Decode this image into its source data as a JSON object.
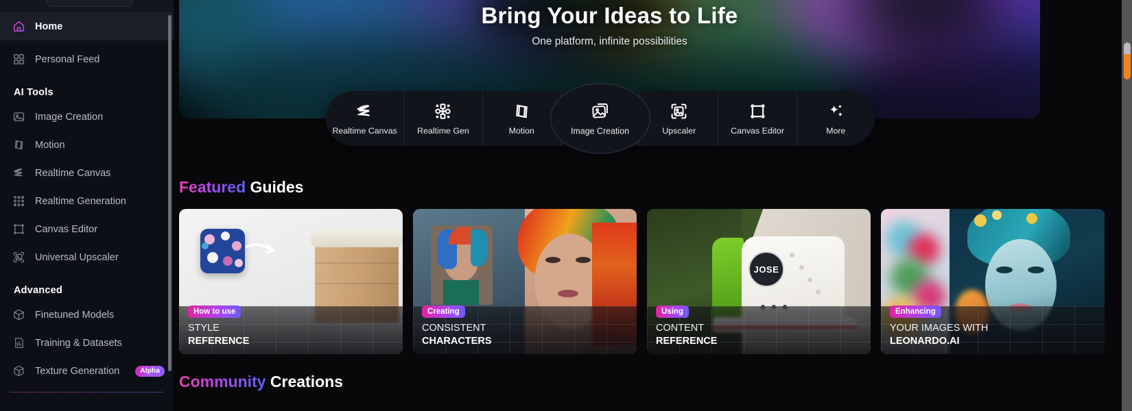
{
  "sidebar": {
    "primary": [
      {
        "label": "Home",
        "icon": "home-icon",
        "active": true
      },
      {
        "label": "Personal Feed",
        "icon": "grid-squares-icon",
        "active": false
      }
    ],
    "sections": [
      {
        "title": "AI Tools",
        "items": [
          {
            "label": "Image Creation",
            "icon": "image-icon"
          },
          {
            "label": "Motion",
            "icon": "film-strip-icon"
          },
          {
            "label": "Realtime Canvas",
            "icon": "scribble-icon"
          },
          {
            "label": "Realtime Generation",
            "icon": "dots-plus-icon"
          },
          {
            "label": "Canvas Editor",
            "icon": "frame-corners-icon"
          },
          {
            "label": "Universal Upscaler",
            "icon": "image-scan-icon"
          }
        ]
      },
      {
        "title": "Advanced",
        "items": [
          {
            "label": "Finetuned Models",
            "icon": "cube-icon"
          },
          {
            "label": "Training & Datasets",
            "icon": "training-icon"
          },
          {
            "label": "Texture Generation",
            "icon": "texture-cube-icon",
            "badge": "Alpha"
          }
        ]
      }
    ]
  },
  "hero": {
    "title": "Bring Your Ideas to Life",
    "subtitle": "One platform, infinite possibilities"
  },
  "toolbar": {
    "items": [
      {
        "label": "Realtime Canvas",
        "icon": "scribble-icon",
        "selected": false
      },
      {
        "label": "Realtime Gen",
        "icon": "dots-plus-icon",
        "selected": false
      },
      {
        "label": "Motion",
        "icon": "film-strip-icon",
        "selected": false
      },
      {
        "label": "Image Creation",
        "icon": "image-stack-icon",
        "selected": true
      },
      {
        "label": "Upscaler",
        "icon": "image-scan-icon",
        "selected": false
      },
      {
        "label": "Canvas Editor",
        "icon": "frame-corners-icon",
        "selected": false
      },
      {
        "label": "More",
        "icon": "sparkles-icon",
        "selected": false
      }
    ]
  },
  "sections": {
    "featured": {
      "accent_word": "Featured",
      "plain_word": " Guides"
    },
    "community": {
      "accent_word": "Community",
      "plain_word": " Creations"
    }
  },
  "cards": [
    {
      "tag": "How to use",
      "line1": "STYLE",
      "line2": "REFERENCE",
      "art": "coffee-cup-floral-style"
    },
    {
      "tag": "Creating",
      "line1": "CONSISTENT",
      "line2": "CHARACTERS",
      "art": "rainbow-hair-portrait"
    },
    {
      "tag": "Using",
      "line1": "CONTENT",
      "line2": "REFERENCE",
      "art": "white-sneaker-jose"
    },
    {
      "tag": "Enhancing",
      "line1": "YOUR IMAGES WITH",
      "line2": "LEONARDO.AI",
      "art": "teal-hair-floral-portrait"
    }
  ],
  "carousel": {
    "prev_icon": "chevron-left-icon",
    "next_icon": "chevron-right-icon",
    "page_next_icon": "play-triangle-icon"
  },
  "colors": {
    "accent_pink": "#ef3fb0",
    "accent_purple": "#a54bf0",
    "accent_blue": "#5b63f0",
    "scrollbar_thumb": "#f0821e",
    "sidebar_bg": "#0d0f16",
    "main_bg": "#08080b"
  }
}
